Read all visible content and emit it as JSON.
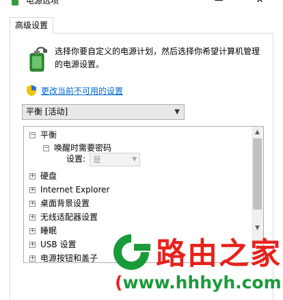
{
  "window": {
    "title": "电源选项",
    "minimize_glyph": "—",
    "close_glyph": "✕"
  },
  "tabs": [
    {
      "label": "高级设置"
    }
  ],
  "header": {
    "description": "选择你要自定义的电源计划，然后选择你希望计算机管理的电源设置。",
    "change_link": "更改当前不可用的设置"
  },
  "plan": {
    "selected": "平衡 [活动]"
  },
  "tree": {
    "nodes": [
      {
        "expander": "⊟",
        "label": "平衡"
      },
      {
        "expander": "⊟",
        "label": "唤醒时需要密码"
      },
      {
        "expander": "⊞",
        "label": "硬盘"
      },
      {
        "expander": "⊞",
        "label": "Internet Explorer"
      },
      {
        "expander": "⊞",
        "label": "桌面背景设置"
      },
      {
        "expander": "⊞",
        "label": "无线适配器设置"
      },
      {
        "expander": "⊞",
        "label": "睡眠"
      },
      {
        "expander": "⊞",
        "label": "USB 设置"
      },
      {
        "expander": "⊞",
        "label": "电源按钮和盖子"
      }
    ],
    "setting_label": "设置:",
    "setting_value": "是"
  },
  "watermark": {
    "cn": "路由之家",
    "url_open": "(",
    "url": "www.hhhyh.com",
    "url_close": ")"
  },
  "colors": {
    "link": "#0066cc",
    "watermark_red": "#e8211c",
    "watermark_green": "#1a9b3a"
  }
}
